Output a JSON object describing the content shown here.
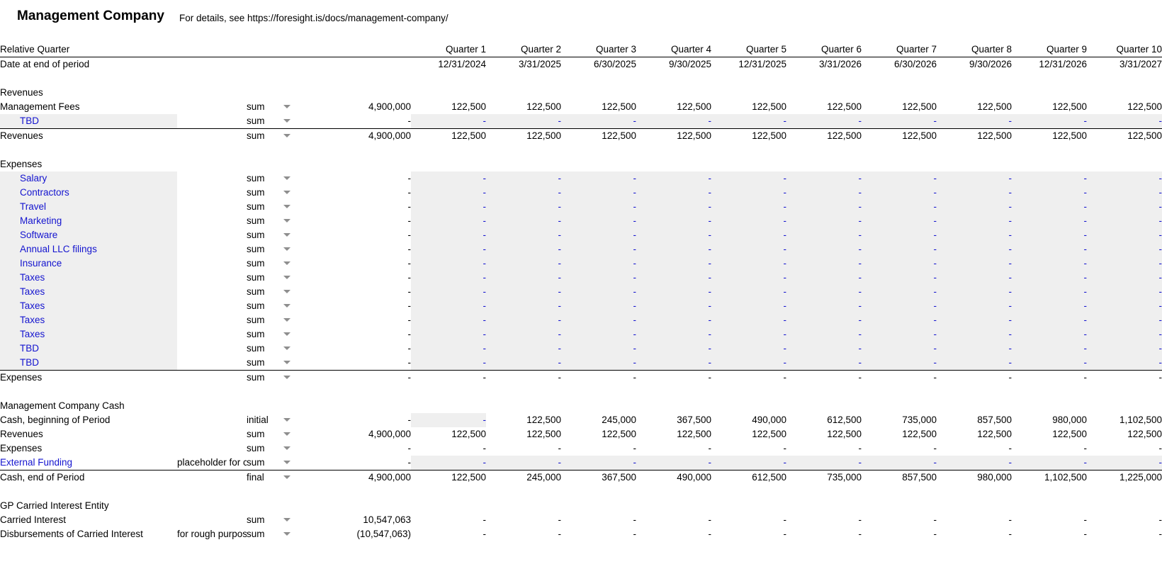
{
  "header": {
    "title": "Management Company",
    "subtitle": "For details, see https://foresight.is/docs/management-company/"
  },
  "columns": {
    "row_label_header": "Relative Quarter",
    "date_row_label": "Date at end of period",
    "quarters": [
      "Quarter 1",
      "Quarter 2",
      "Quarter 3",
      "Quarter 4",
      "Quarter 5",
      "Quarter 6",
      "Quarter 7",
      "Quarter 8",
      "Quarter 9",
      "Quarter 10"
    ],
    "dates": [
      "12/31/2024",
      "3/31/2025",
      "6/30/2025",
      "9/30/2025",
      "12/31/2025",
      "3/31/2026",
      "6/30/2026",
      "9/30/2026",
      "12/31/2026",
      "3/31/2027"
    ]
  },
  "colors": {
    "editable_text": "#1414cf",
    "shaded_cell": "#efefef",
    "text": "#000000",
    "caret": "#8e8e8e"
  },
  "icons": {
    "dropdown": "chevron-down-icon"
  },
  "sections": [
    {
      "name": "Revenues",
      "heading": "Revenues",
      "rows": [
        {
          "label": "Management Fees",
          "note": "",
          "agg": "sum",
          "total": "4,900,000",
          "values": [
            "122,500",
            "122,500",
            "122,500",
            "122,500",
            "122,500",
            "122,500",
            "122,500",
            "122,500",
            "122,500",
            "122,500"
          ],
          "label_shaded": false,
          "values_shaded": false,
          "editable": false,
          "bottom_border": false
        },
        {
          "label": "TBD",
          "note": "",
          "agg": "sum",
          "total": "-",
          "values": [
            "-",
            "-",
            "-",
            "-",
            "-",
            "-",
            "-",
            "-",
            "-",
            "-"
          ],
          "label_shaded": true,
          "values_shaded": true,
          "editable": true,
          "indent": true,
          "bottom_border": true
        },
        {
          "label": "Revenues",
          "note": "",
          "agg": "sum",
          "total": "4,900,000",
          "values": [
            "122,500",
            "122,500",
            "122,500",
            "122,500",
            "122,500",
            "122,500",
            "122,500",
            "122,500",
            "122,500",
            "122,500"
          ],
          "label_shaded": false,
          "values_shaded": false,
          "editable": false,
          "bottom_border": false
        }
      ]
    },
    {
      "name": "Expenses",
      "heading": "Expenses",
      "rows": [
        {
          "label": "Salary",
          "note": "",
          "agg": "sum",
          "total": "-",
          "values": [
            "-",
            "-",
            "-",
            "-",
            "-",
            "-",
            "-",
            "-",
            "-",
            "-"
          ],
          "label_shaded": true,
          "values_shaded": true,
          "editable": true,
          "indent": true
        },
        {
          "label": "Contractors",
          "note": "",
          "agg": "sum",
          "total": "-",
          "values": [
            "-",
            "-",
            "-",
            "-",
            "-",
            "-",
            "-",
            "-",
            "-",
            "-"
          ],
          "label_shaded": true,
          "values_shaded": true,
          "editable": true,
          "indent": true
        },
        {
          "label": "Travel",
          "note": "",
          "agg": "sum",
          "total": "-",
          "values": [
            "-",
            "-",
            "-",
            "-",
            "-",
            "-",
            "-",
            "-",
            "-",
            "-"
          ],
          "label_shaded": true,
          "values_shaded": true,
          "editable": true,
          "indent": true
        },
        {
          "label": "Marketing",
          "note": "",
          "agg": "sum",
          "total": "-",
          "values": [
            "-",
            "-",
            "-",
            "-",
            "-",
            "-",
            "-",
            "-",
            "-",
            "-"
          ],
          "label_shaded": true,
          "values_shaded": true,
          "editable": true,
          "indent": true
        },
        {
          "label": "Software",
          "note": "",
          "agg": "sum",
          "total": "-",
          "values": [
            "-",
            "-",
            "-",
            "-",
            "-",
            "-",
            "-",
            "-",
            "-",
            "-"
          ],
          "label_shaded": true,
          "values_shaded": true,
          "editable": true,
          "indent": true
        },
        {
          "label": "Annual LLC filings",
          "note": "",
          "agg": "sum",
          "total": "-",
          "values": [
            "-",
            "-",
            "-",
            "-",
            "-",
            "-",
            "-",
            "-",
            "-",
            "-"
          ],
          "label_shaded": true,
          "values_shaded": true,
          "editable": true,
          "indent": true
        },
        {
          "label": "Insurance",
          "note": "",
          "agg": "sum",
          "total": "-",
          "values": [
            "-",
            "-",
            "-",
            "-",
            "-",
            "-",
            "-",
            "-",
            "-",
            "-"
          ],
          "label_shaded": true,
          "values_shaded": true,
          "editable": true,
          "indent": true
        },
        {
          "label": "Taxes",
          "note": "",
          "agg": "sum",
          "total": "-",
          "values": [
            "-",
            "-",
            "-",
            "-",
            "-",
            "-",
            "-",
            "-",
            "-",
            "-"
          ],
          "label_shaded": true,
          "values_shaded": true,
          "editable": true,
          "indent": true
        },
        {
          "label": "Taxes",
          "note": "",
          "agg": "sum",
          "total": "-",
          "values": [
            "-",
            "-",
            "-",
            "-",
            "-",
            "-",
            "-",
            "-",
            "-",
            "-"
          ],
          "label_shaded": true,
          "values_shaded": true,
          "editable": true,
          "indent": true
        },
        {
          "label": "Taxes",
          "note": "",
          "agg": "sum",
          "total": "-",
          "values": [
            "-",
            "-",
            "-",
            "-",
            "-",
            "-",
            "-",
            "-",
            "-",
            "-"
          ],
          "label_shaded": true,
          "values_shaded": true,
          "editable": true,
          "indent": true
        },
        {
          "label": "Taxes",
          "note": "",
          "agg": "sum",
          "total": "-",
          "values": [
            "-",
            "-",
            "-",
            "-",
            "-",
            "-",
            "-",
            "-",
            "-",
            "-"
          ],
          "label_shaded": true,
          "values_shaded": true,
          "editable": true,
          "indent": true
        },
        {
          "label": "Taxes",
          "note": "",
          "agg": "sum",
          "total": "-",
          "values": [
            "-",
            "-",
            "-",
            "-",
            "-",
            "-",
            "-",
            "-",
            "-",
            "-"
          ],
          "label_shaded": true,
          "values_shaded": true,
          "editable": true,
          "indent": true
        },
        {
          "label": "TBD",
          "note": "",
          "agg": "sum",
          "total": "-",
          "values": [
            "-",
            "-",
            "-",
            "-",
            "-",
            "-",
            "-",
            "-",
            "-",
            "-"
          ],
          "label_shaded": true,
          "values_shaded": true,
          "editable": true,
          "indent": true
        },
        {
          "label": "TBD",
          "note": "",
          "agg": "sum",
          "total": "-",
          "values": [
            "-",
            "-",
            "-",
            "-",
            "-",
            "-",
            "-",
            "-",
            "-",
            "-"
          ],
          "label_shaded": true,
          "values_shaded": true,
          "editable": true,
          "indent": true,
          "bottom_border": true
        },
        {
          "label": "Expenses",
          "note": "",
          "agg": "sum",
          "total": "-",
          "values": [
            "-",
            "-",
            "-",
            "-",
            "-",
            "-",
            "-",
            "-",
            "-",
            "-"
          ],
          "label_shaded": false,
          "values_shaded": false,
          "editable": false
        }
      ]
    },
    {
      "name": "Management Company Cash",
      "heading": "Management Company Cash",
      "rows": [
        {
          "label": "Cash, beginning of Period",
          "note": "",
          "agg": "initial",
          "total": "-",
          "values": [
            "-",
            "122,500",
            "245,000",
            "367,500",
            "490,000",
            "612,500",
            "735,000",
            "857,500",
            "980,000",
            "1,102,500"
          ],
          "label_shaded": false,
          "first_cell_shaded": true,
          "first_cell_editable": true,
          "editable": false
        },
        {
          "label": "Revenues",
          "note": "",
          "agg": "sum",
          "total": "4,900,000",
          "values": [
            "122,500",
            "122,500",
            "122,500",
            "122,500",
            "122,500",
            "122,500",
            "122,500",
            "122,500",
            "122,500",
            "122,500"
          ],
          "label_shaded": false,
          "values_shaded": false,
          "editable": false
        },
        {
          "label": "Expenses",
          "note": "",
          "agg": "sum",
          "total": "-",
          "values": [
            "-",
            "-",
            "-",
            "-",
            "-",
            "-",
            "-",
            "-",
            "-",
            "-"
          ],
          "label_shaded": false,
          "values_shaded": false,
          "editable": false
        },
        {
          "label": "External Funding",
          "note": "placeholder for c",
          "agg": "sum",
          "total": "-",
          "values": [
            "-",
            "-",
            "-",
            "-",
            "-",
            "-",
            "-",
            "-",
            "-",
            "-"
          ],
          "label_shaded": false,
          "values_shaded": true,
          "editable": true,
          "bottom_border": true
        },
        {
          "label": "Cash, end of Period",
          "note": "",
          "agg": "final",
          "total": "4,900,000",
          "values": [
            "122,500",
            "245,000",
            "367,500",
            "490,000",
            "612,500",
            "735,000",
            "857,500",
            "980,000",
            "1,102,500",
            "1,225,000"
          ],
          "label_shaded": false,
          "values_shaded": false,
          "editable": false
        }
      ]
    },
    {
      "name": "GP Carried Interest Entity",
      "heading": "GP Carried Interest Entity",
      "rows": [
        {
          "label": "Carried Interest",
          "note": "",
          "agg": "sum",
          "total": "10,547,063",
          "values": [
            "-",
            "-",
            "-",
            "-",
            "-",
            "-",
            "-",
            "-",
            "-",
            "-"
          ],
          "label_shaded": false,
          "values_shaded": false,
          "editable": false
        },
        {
          "label": "Disbursements of Carried Interest",
          "note": "for rough purpos",
          "agg": "sum",
          "total": "(10,547,063)",
          "values": [
            "-",
            "-",
            "-",
            "-",
            "-",
            "-",
            "-",
            "-",
            "-",
            "-"
          ],
          "label_shaded": false,
          "values_shaded": false,
          "editable": false
        }
      ]
    }
  ]
}
